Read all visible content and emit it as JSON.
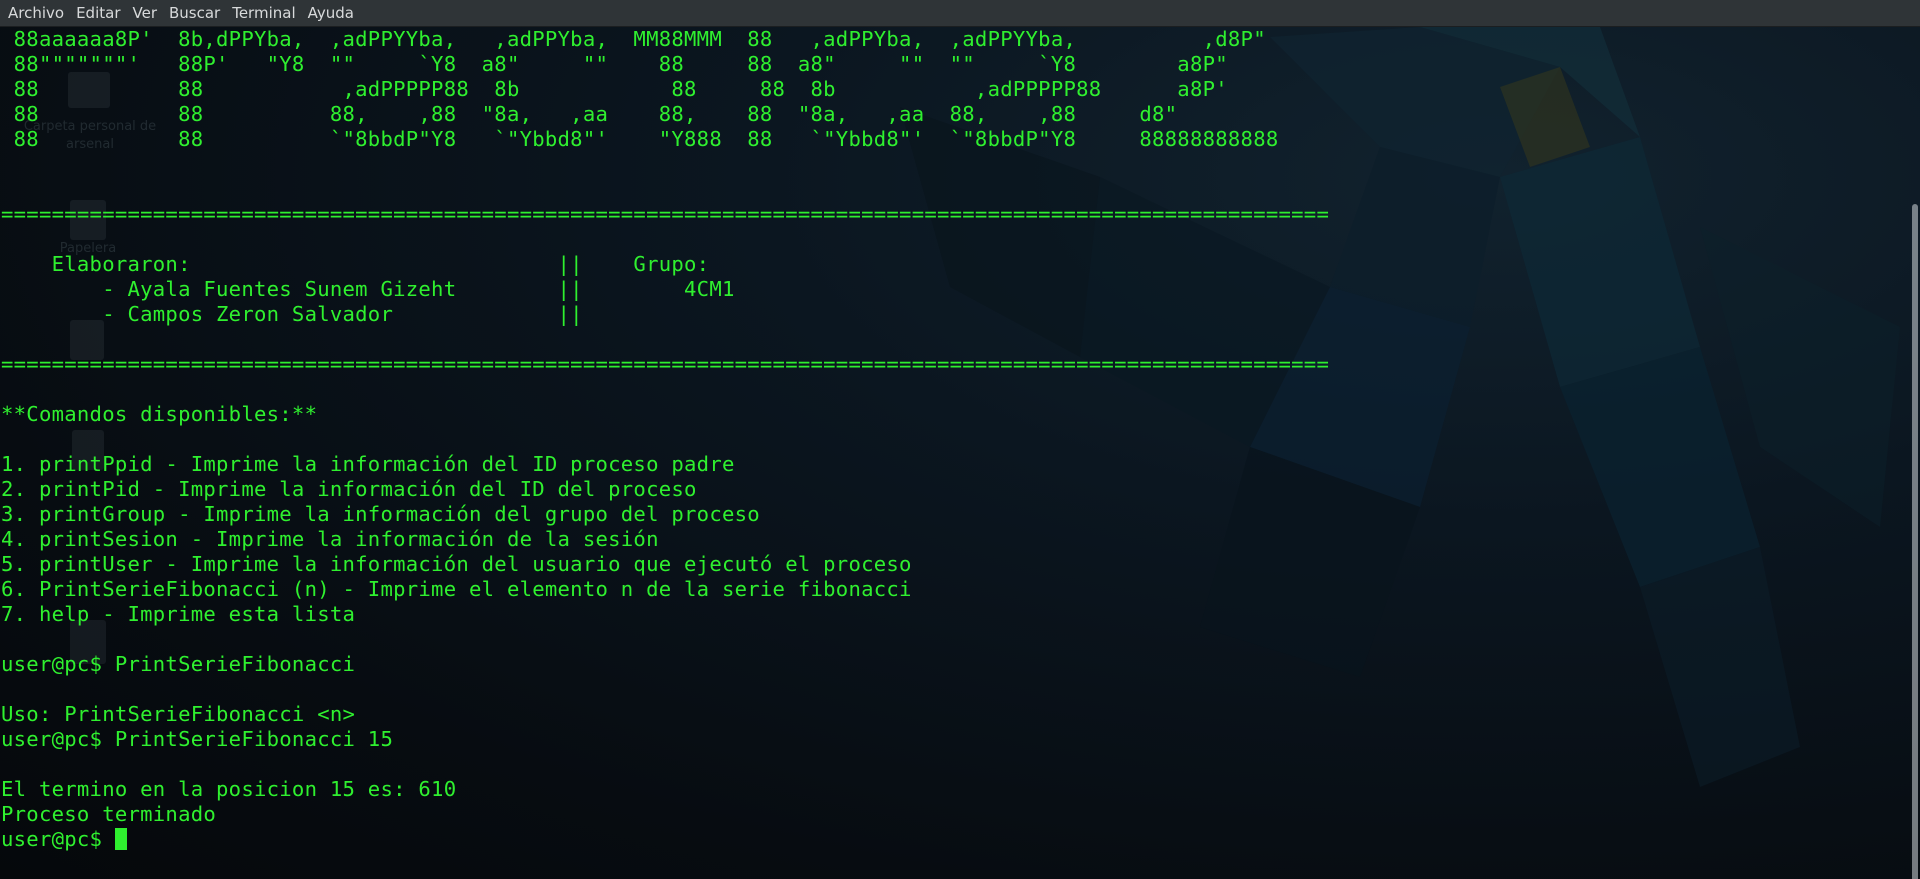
{
  "menubar": {
    "items": [
      "Archivo",
      "Editar",
      "Ver",
      "Buscar",
      "Terminal",
      "Ayuda"
    ]
  },
  "desktop_ghost": {
    "home_label": "Carpeta personal de\narsenal",
    "trash_label": "Papelera"
  },
  "terminal": {
    "lines": [
      " 88aaaaaa8P'  8b,dPPYba,  ,adPPYYba,   ,adPPYba,  MM88MMM  88   ,adPPYba,  ,adPPYYba,          ,d8P\"",
      " 88\"\"\"\"\"\"\"'   88P'   \"Y8  \"\"     `Y8  a8\"     \"\"    88     88  a8\"     \"\"  \"\"     `Y8        a8P\"",
      " 88           88           ,adPPPPP88  8b            88     88  8b           ,adPPPPP88      a8P'",
      " 88           88          88,    ,88  \"8a,   ,aa    88,    88  \"8a,   ,aa  88,    ,88     d8\"",
      " 88           88          `\"8bbdP\"Y8   `\"Ybbd8\"'    \"Y888  88   `\"Ybbd8\"'  `\"8bbdP\"Y8     88888888888",
      "",
      "",
      "=========================================================================================================",
      "",
      "    Elaboraron:                             ||    Grupo:",
      "        - Ayala Fuentes Sunem Gizeht        ||        4CM1",
      "        - Campos Zeron Salvador             ||",
      "",
      "=========================================================================================================",
      "",
      "**Comandos disponibles:**",
      "",
      "1. printPpid - Imprime la información del ID proceso padre",
      "2. printPid - Imprime la información del ID del proceso",
      "3. printGroup - Imprime la información del grupo del proceso",
      "4. printSesion - Imprime la información de la sesión",
      "5. printUser - Imprime la información del usuario que ejecutó el proceso",
      "6. PrintSerieFibonacci (n) - Imprime el elemento n de la serie fibonacci",
      "7. help - Imprime esta lista",
      "",
      "user@pc$ PrintSerieFibonacci",
      "",
      "Uso: PrintSerieFibonacci <n>",
      "user@pc$ PrintSerieFibonacci 15",
      "",
      "El termino en la posicion 15 es: 610",
      "Proceso terminado",
      ""
    ],
    "prompt": "user@pc$ "
  },
  "colors": {
    "terminal_text": "#2ff02f",
    "menubar_bg": "#2f3437",
    "menubar_text": "#d8dadb",
    "background": "#0b1117"
  }
}
